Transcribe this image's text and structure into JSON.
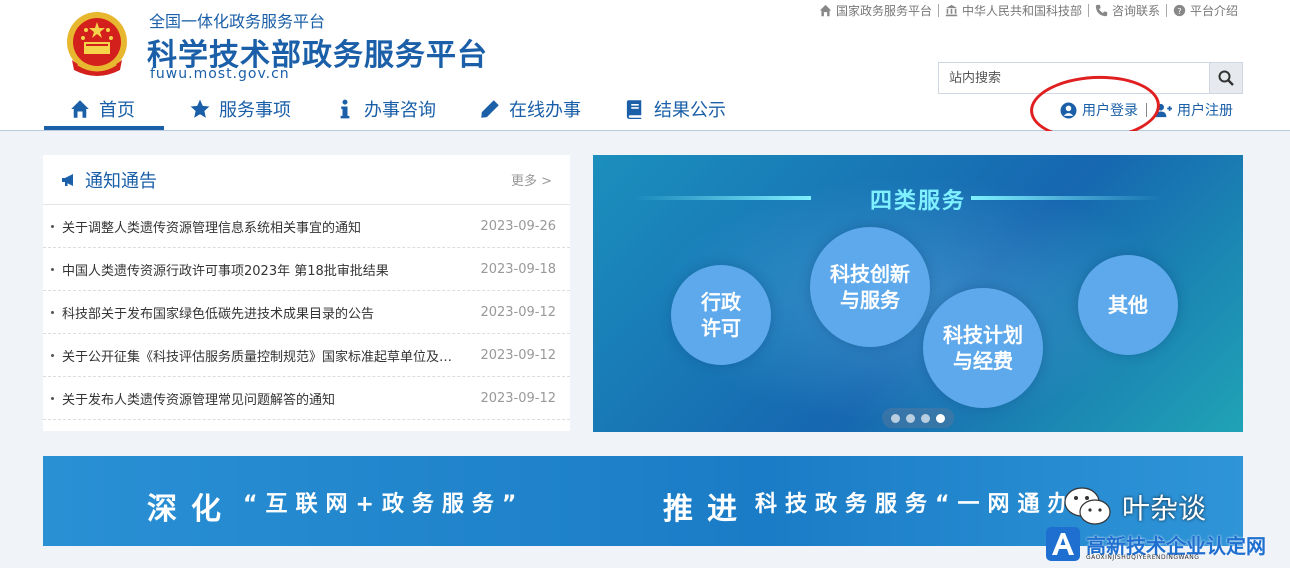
{
  "header": {
    "platform_sub": "全国一体化政务服务平台",
    "platform_title": "科学技术部政务服务平台",
    "platform_url": "fuwu.most.gov.cn"
  },
  "toplinks": [
    {
      "label": "国家政务服务平台",
      "icon": "home-icon"
    },
    {
      "label": "中华人民共和国科技部",
      "icon": "bank-icon"
    },
    {
      "label": "咨询联系",
      "icon": "phone-icon"
    },
    {
      "label": "平台介绍",
      "icon": "question-icon"
    }
  ],
  "search": {
    "placeholder": "站内搜索"
  },
  "auth": {
    "login": "用户登录",
    "register": "用户注册"
  },
  "nav": [
    {
      "label": "首页",
      "icon": "home-icon",
      "active": true
    },
    {
      "label": "服务事项",
      "icon": "star-icon"
    },
    {
      "label": "办事咨询",
      "icon": "info-icon"
    },
    {
      "label": "在线办事",
      "icon": "pencil-icon"
    },
    {
      "label": "结果公示",
      "icon": "book-icon"
    }
  ],
  "notice": {
    "title": "通知通告",
    "more": "更多 >",
    "items": [
      {
        "title": "关于调整人类遗传资源管理信息系统相关事宜的通知",
        "date": "2023-09-26"
      },
      {
        "title": "中国人类遗传资源行政许可事项2023年 第18批审批结果",
        "date": "2023-09-18"
      },
      {
        "title": "科技部关于发布国家绿色低碳先进技术成果目录的公告",
        "date": "2023-09-12"
      },
      {
        "title": "关于公开征集《科技评估服务质量控制规范》国家标准起草单位及…",
        "date": "2023-09-12"
      },
      {
        "title": "关于发布人类遗传资源管理常见问题解答的通知",
        "date": "2023-09-12"
      }
    ]
  },
  "banner": {
    "title": "四类服务",
    "bubbles": [
      "行政许可",
      "科技创新与服务",
      "科技计划与经费",
      "其他"
    ],
    "slides": 4,
    "active_slide": 4
  },
  "slogan": {
    "part1": "深化",
    "part2": "“互联网+政务服务”",
    "part3": "推进",
    "part4": "科技政务服务“一网通办”"
  },
  "watermark": {
    "wechat_name": "叶杂谈",
    "site_name": "高新技术企业认定网",
    "site_pinyin": "GAOXINJISHUQIYERENDINGWANG"
  },
  "colors": {
    "primary": "#1a5fa8",
    "highlight_circle": "#e02020",
    "banner_title": "#7ff0ff"
  }
}
